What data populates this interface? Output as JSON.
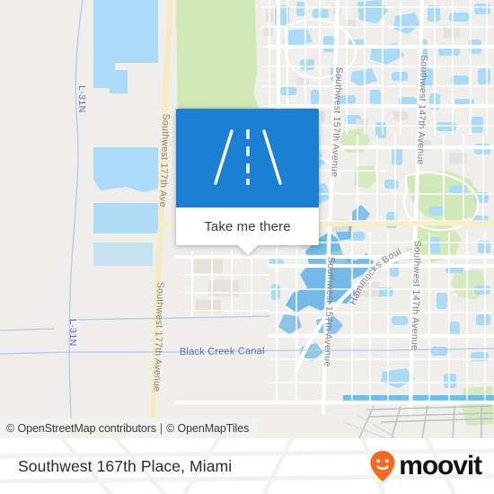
{
  "map": {
    "provider_attribution": {
      "osm": "© OpenStreetMap contributors",
      "separator": "|",
      "tiles": "© OpenMapTiles"
    },
    "street_labels": [
      {
        "name": "L-31N",
        "kind": "canal"
      },
      {
        "name": "L-31N",
        "kind": "canal"
      },
      {
        "name": "Southwest 177th Avenue",
        "kind": "road"
      },
      {
        "name": "Southwest 177th Avenue",
        "kind": "road"
      },
      {
        "name": "Southwest 157th Avenue",
        "kind": "road"
      },
      {
        "name": "Southwest 157th Avenue",
        "kind": "road"
      },
      {
        "name": "Southwest 147th Avenue",
        "kind": "road"
      },
      {
        "name": "Southwest 147th Avenue",
        "kind": "road"
      },
      {
        "name": "Hammocks Boulevard",
        "kind": "road"
      },
      {
        "name": "Black Creek Canal",
        "kind": "waterway"
      }
    ],
    "colors": {
      "land": "#efeeeb",
      "water": "#aadaf5",
      "green": "#cfe8b5",
      "road_white": "#ffffff",
      "road_yellow": "#f7eec4",
      "label_road": "#7d7d86",
      "label_water": "#5b6bc0",
      "building": "#e6e3dd"
    }
  },
  "popup": {
    "icon": "road-icon",
    "header_color": "#1b80d2",
    "action_label": "Take me there"
  },
  "footer": {
    "place_title": "Southwest 167th Place, Miami",
    "brand_name": "moovit",
    "brand_color": "#f26b21",
    "brand_icon": "moovit-pin-smile-icon"
  }
}
